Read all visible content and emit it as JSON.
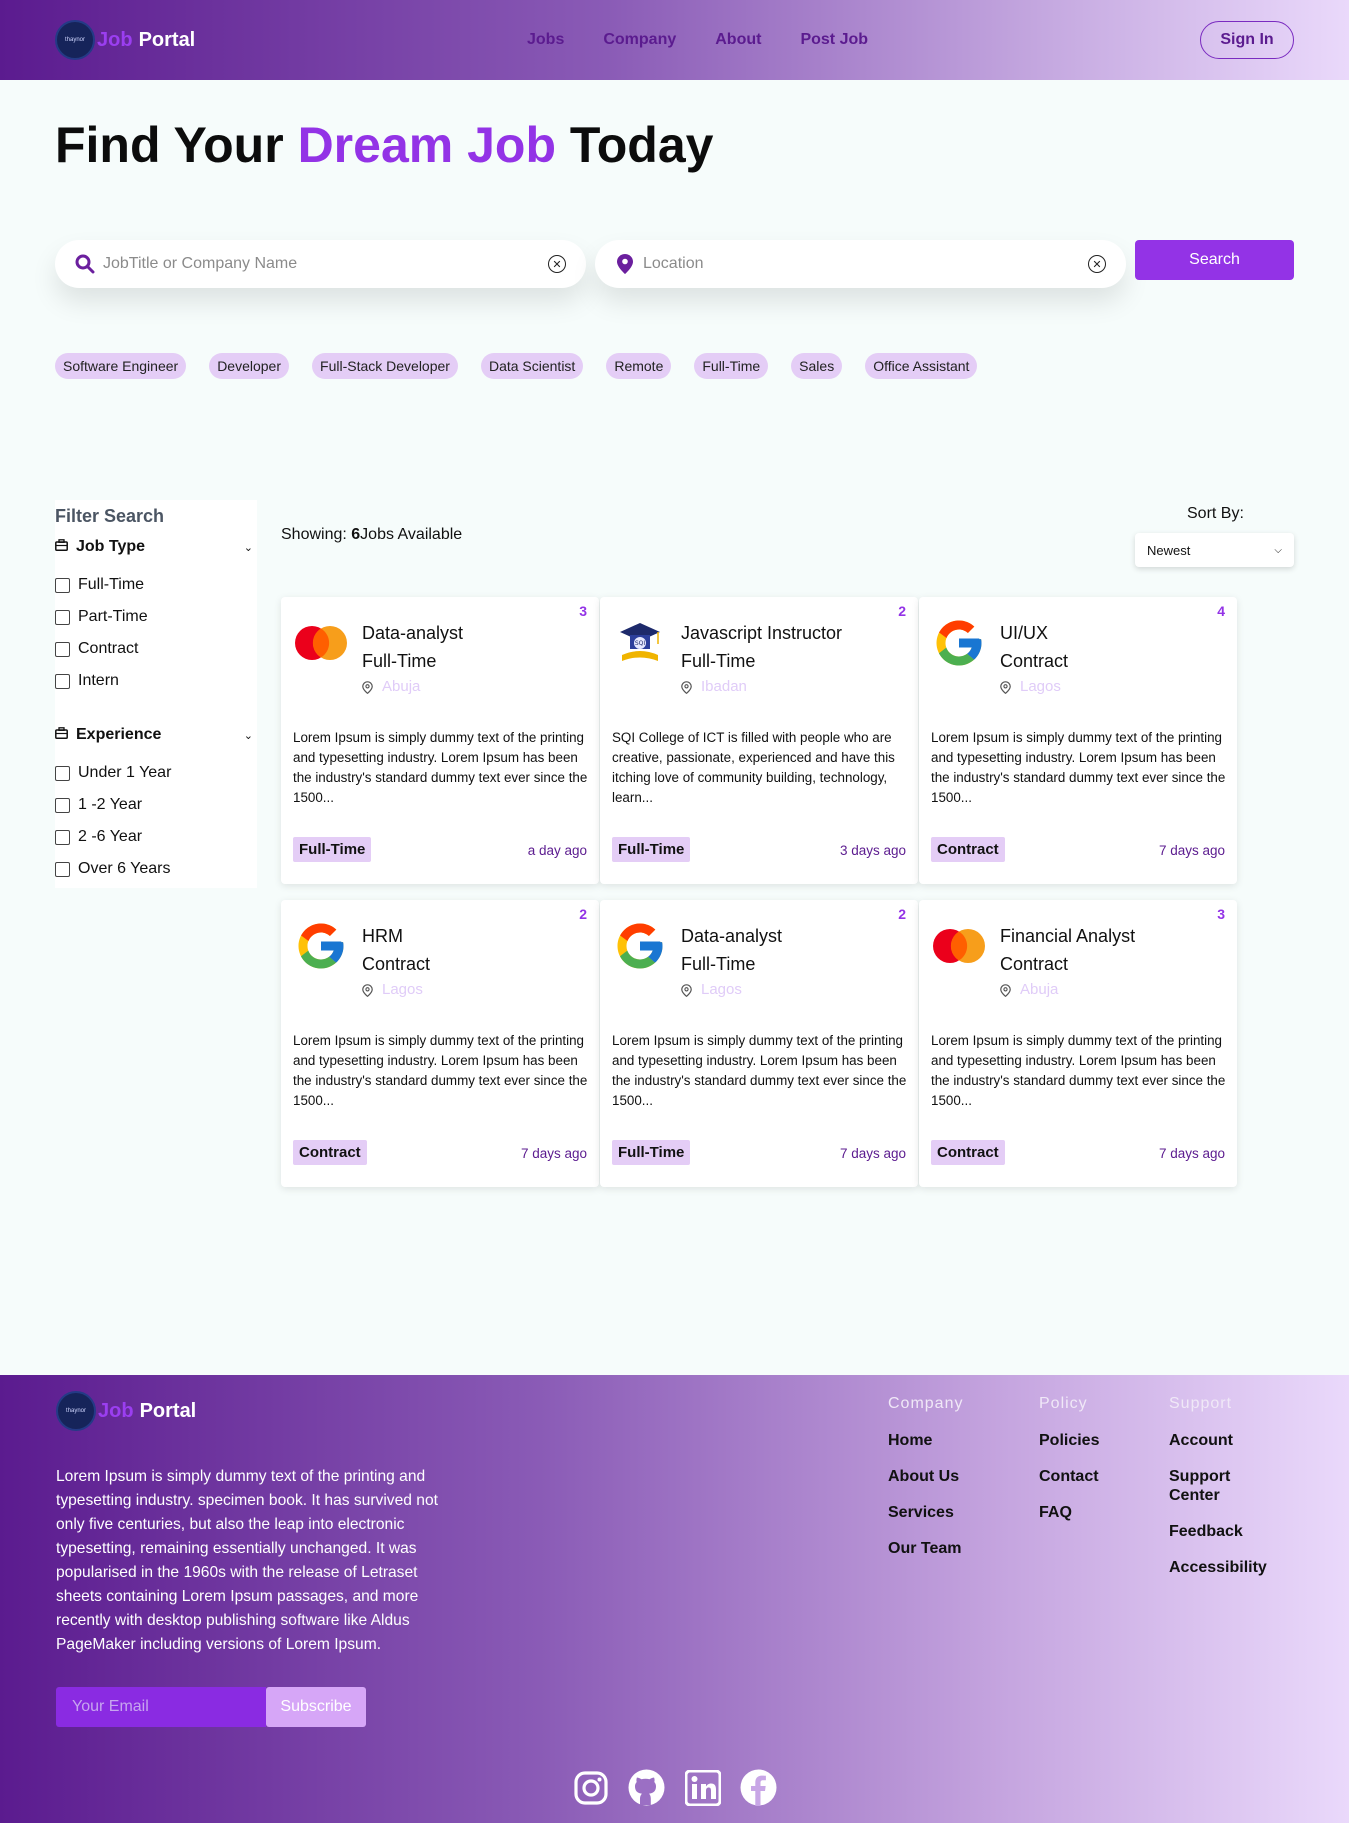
{
  "header": {
    "logo_badge": "thaynor",
    "logo_job": "Job",
    "logo_portal": "Portal",
    "nav": [
      "Jobs",
      "Company",
      "About",
      "Post Job"
    ],
    "signin": "Sign In"
  },
  "hero": {
    "title_pre": "Find Your ",
    "title_accent": "Dream Job",
    "title_post": " Today"
  },
  "search": {
    "keyword_placeholder": "JobTitle or Company Name",
    "location_placeholder": "Location",
    "button": "Search"
  },
  "tags": [
    "Software Engineer",
    "Developer",
    "Full-Stack Developer",
    "Data Scientist",
    "Remote",
    "Full-Time",
    "Sales",
    "Office Assistant"
  ],
  "filters": {
    "title": "Filter Search",
    "job_type": {
      "label": "Job Type",
      "options": [
        "Full-Time",
        "Part-Time",
        "Contract",
        "Intern"
      ]
    },
    "experience": {
      "label": "Experience",
      "options": [
        "Under 1 Year",
        "1 -2 Year",
        "2 -6 Year",
        "Over 6 Years"
      ]
    }
  },
  "listing": {
    "showing_label": "Showing: ",
    "count": "6",
    "count_suffix": "Jobs Available",
    "sort_label": "Sort By:",
    "sort_value": "Newest"
  },
  "jobs": [
    {
      "count": "3",
      "logo": "mastercard-logo",
      "title": "Data-analyst",
      "type_line": "Full-Time",
      "location": "Abuja",
      "desc": "Lorem Ipsum is simply dummy text of the printing and typesetting industry. Lorem Ipsum has been the industry's standard dummy text ever since the 1500...",
      "badge": "Full-Time",
      "time": "a day ago"
    },
    {
      "count": "2",
      "logo": "sqi-college-logo",
      "title": "Javascript Instructor",
      "type_line": "Full-Time",
      "location": "Ibadan",
      "desc": "SQI College of ICT is filled with people who are creative, passionate, experienced and have this itching love of community building, technology, learn...",
      "badge": "Full-Time",
      "time": "3 days ago"
    },
    {
      "count": "4",
      "logo": "google-logo",
      "title": "UI/UX",
      "type_line": "Contract",
      "location": "Lagos",
      "desc": "Lorem Ipsum is simply dummy text of the printing and typesetting industry. Lorem Ipsum has been the industry's standard dummy text ever since the 1500...",
      "badge": "Contract",
      "time": "7 days ago"
    },
    {
      "count": "2",
      "logo": "google-logo",
      "title": "HRM",
      "type_line": "Contract",
      "location": "Lagos",
      "desc": "Lorem Ipsum is simply dummy text of the printing and typesetting industry. Lorem Ipsum has been the industry's standard dummy text ever since the 1500...",
      "badge": "Contract",
      "time": "7 days ago"
    },
    {
      "count": "2",
      "logo": "google-logo",
      "title": "Data-analyst",
      "type_line": "Full-Time",
      "location": "Lagos",
      "desc": "Lorem Ipsum is simply dummy text of the printing and typesetting industry. Lorem Ipsum has been the industry's standard dummy text ever since the 1500...",
      "badge": "Full-Time",
      "time": "7 days ago"
    },
    {
      "count": "3",
      "logo": "mastercard-logo",
      "title": "Financial Analyst",
      "type_line": "Contract",
      "location": "Abuja",
      "desc": "Lorem Ipsum is simply dummy text of the printing and typesetting industry. Lorem Ipsum has been the industry's standard dummy text ever since the 1500...",
      "badge": "Contract",
      "time": "7 days ago"
    }
  ],
  "footer": {
    "logo_badge": "thaynor",
    "logo_job": "Job",
    "logo_portal": "Portal",
    "about": "Lorem Ipsum is simply dummy text of the printing and typesetting industry. specimen book. It has survived not only five centuries, but also the leap into electronic typesetting, remaining essentially unchanged. It was popularised in the 1960s with the release of Letraset sheets containing Lorem Ipsum passages, and more recently with desktop publishing software like Aldus PageMaker including versions of Lorem Ipsum.",
    "email_placeholder": "Your Email",
    "subscribe": "Subscribe",
    "columns": [
      {
        "heading": "Company",
        "items": [
          "Home",
          "About Us",
          "Services",
          "Our Team"
        ]
      },
      {
        "heading": "Policy",
        "items": [
          "Policies",
          "Contact",
          "FAQ"
        ]
      },
      {
        "heading": "Support",
        "items": [
          "Account",
          "Support Center",
          "Feedback",
          "Accessibility"
        ]
      }
    ],
    "socials": [
      "instagram-icon",
      "github-icon",
      "linkedin-icon",
      "facebook-icon"
    ]
  },
  "colors": {
    "accent": "#9333e6",
    "header_start": "#5b1b8f",
    "tag_bg": "#e4cdf6"
  }
}
